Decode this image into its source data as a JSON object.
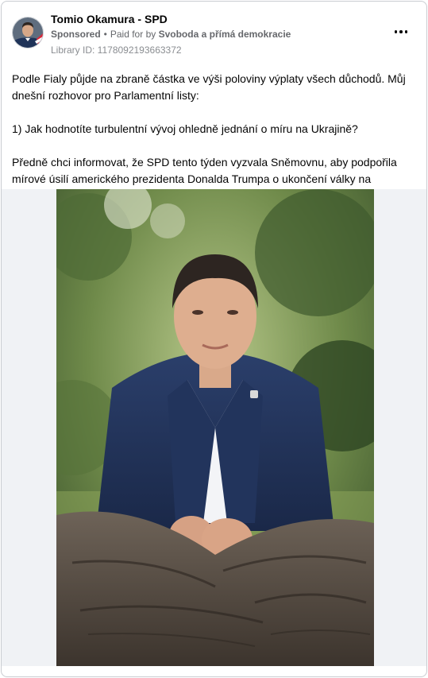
{
  "post": {
    "page_name": "Tomio Okamura - SPD",
    "sponsored_label": "Sponsored",
    "separator": "•",
    "paid_for_prefix": "Paid for by",
    "payer": "Svoboda a přímá demokracie",
    "library_id": "Library ID: 1178092193663372",
    "paragraphs": [
      "Podle Fialy půjde na zbraně částka ve výši poloviny výplaty všech důchodů. Můj dnešní rozhovor pro Parlamentní listy:",
      "1) Jak hodnotíte turbulentní vývoj ohledně jednání o míru na Ukrajině?",
      "Předně chci informovat, že SPD tento týden vyzvala Sněmovnu, aby podpořila mírové úsilí amerického prezidenta Donalda Trumpa o ukončení války na Ukrajině..."
    ]
  },
  "icons": {
    "more": "more-horizontal-icon",
    "avatar": "profile-avatar"
  },
  "colors": {
    "text_primary": "#050505",
    "text_secondary": "#65676b",
    "border": "#c9ccd1",
    "media_background": "#f0f2f5"
  }
}
